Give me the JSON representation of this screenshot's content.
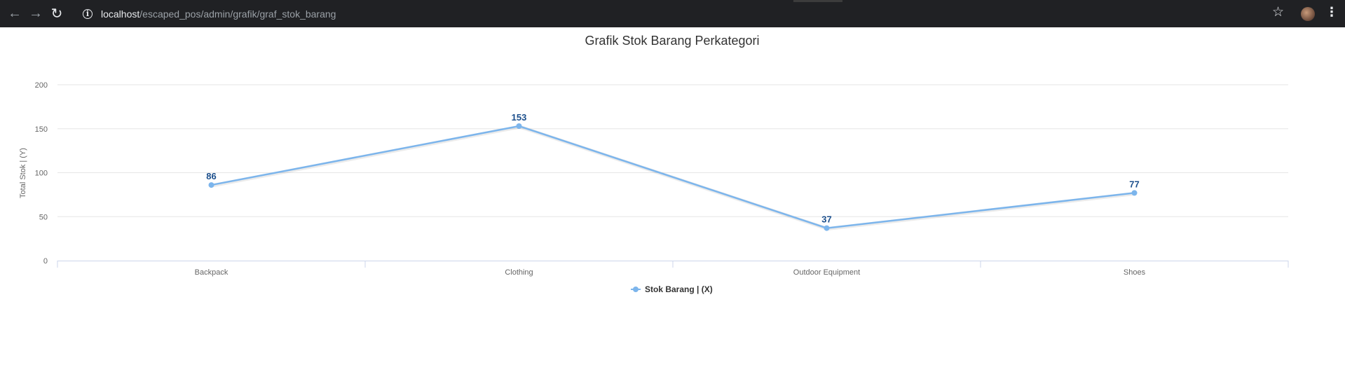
{
  "browser": {
    "url_host": "localhost",
    "url_path": "/escaped_pos/admin/grafik/graf_stok_barang",
    "icons": {
      "back": "arrow-left-icon",
      "forward": "arrow-right-icon",
      "reload": "reload-icon",
      "info": "info-icon",
      "bookmark": "star-icon",
      "menu": "kebab-menu-icon"
    }
  },
  "chart_data": {
    "type": "line",
    "title": "Grafik Stok Barang Perkategori",
    "ylabel": "Total Stok | (Y)",
    "xlabel": "",
    "categories": [
      "Backpack",
      "Clothing",
      "Outdoor Equipment",
      "Shoes"
    ],
    "yticks": [
      "0",
      "50",
      "100",
      "150",
      "200"
    ],
    "ylim": [
      0,
      200
    ],
    "grid": true,
    "legend_position": "bottom-center",
    "series": [
      {
        "name": "Stok Barang | (X)",
        "values": [
          86,
          153,
          37,
          77
        ],
        "color": "#7cb5ec"
      }
    ],
    "data_label_color": "#1c4f8c"
  }
}
